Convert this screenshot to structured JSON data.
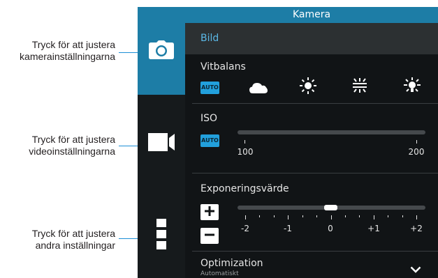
{
  "callouts": {
    "camera": {
      "line1": "Tryck för att justera",
      "line2": "kamerainställningarna"
    },
    "video": {
      "line1": "Tryck för att justera",
      "line2": "videoinställningarna"
    },
    "other": {
      "line1": "Tryck för att justera",
      "line2": "andra inställningar"
    }
  },
  "sidebar": {
    "items": [
      {
        "icon": "camera-icon",
        "active": true
      },
      {
        "icon": "video-camera-icon",
        "active": false
      },
      {
        "icon": "more-options-icon",
        "active": false
      }
    ]
  },
  "panel": {
    "title": "Kamera",
    "section": "Bild",
    "white_balance": {
      "label": "Vitbalans",
      "selected": "AUTO",
      "options": [
        {
          "icon": "auto-badge",
          "text": "AUTO"
        },
        {
          "icon": "cloud-icon"
        },
        {
          "icon": "sun-icon"
        },
        {
          "icon": "fluorescent-icon"
        },
        {
          "icon": "incandescent-icon"
        }
      ]
    },
    "iso": {
      "label": "ISO",
      "auto_badge": "AUTO",
      "scale_min": "100",
      "scale_max": "200"
    },
    "exposure": {
      "label": "Exponeringsvärde",
      "value": 0,
      "scale_labels": [
        "-2",
        "-1",
        "0",
        "+1",
        "+2"
      ]
    },
    "optimization": {
      "label": "Optimization",
      "value": "Automatiskt"
    }
  },
  "colors": {
    "accent": "#1d7da6",
    "callout_line": "#1c8fd6",
    "auto_badge": "#22a0dc",
    "panel_bg": "#111416",
    "sidebar_bg": "#161a1c"
  }
}
